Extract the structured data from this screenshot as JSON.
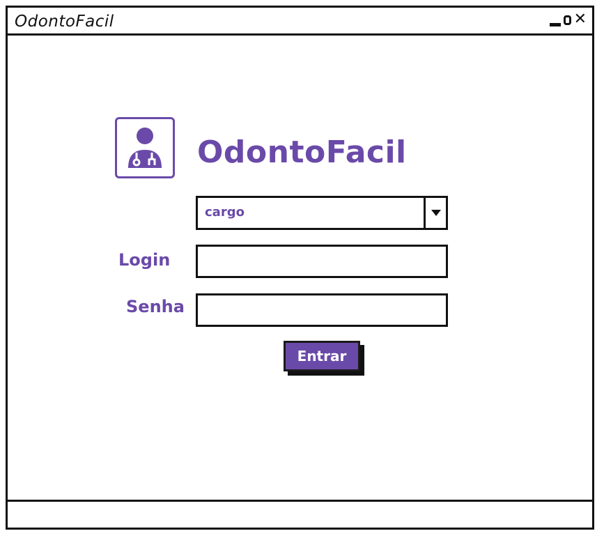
{
  "window": {
    "title": "OdontoFacil",
    "controls": {
      "minimize_icon": "minimize-icon",
      "maximize_icon": "maximize-icon",
      "close_icon": "close-icon"
    }
  },
  "brand": {
    "name": "OdontoFacil",
    "logo_icon": "doctor-stethoscope-icon",
    "accent_color": "#6a4aa9"
  },
  "form": {
    "role_select": {
      "selected": "cargo",
      "arrow_icon": "dropdown-arrow-icon"
    },
    "login": {
      "label": "Login",
      "value": ""
    },
    "senha": {
      "label": "Senha",
      "value": ""
    },
    "submit_label": "Entrar"
  },
  "statusbar": {
    "text": ""
  }
}
